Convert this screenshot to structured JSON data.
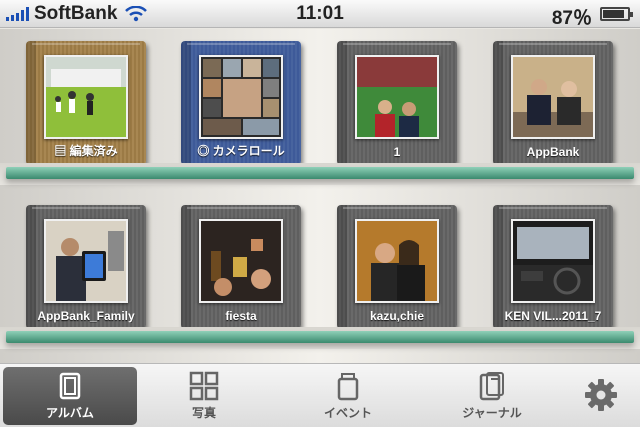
{
  "status_bar": {
    "carrier": "SoftBank",
    "time": "11:01",
    "battery_percent": "87％",
    "battery_level": 0.87
  },
  "shelves": [
    {
      "albums": [
        {
          "label": "編集済み",
          "icon": "edited-icon",
          "cover": "leather",
          "photo_scene": "soccer-field"
        },
        {
          "label": "カメラロール",
          "icon": "camera-roll-icon",
          "cover": "blue",
          "photo_scene": "collage"
        },
        {
          "label": "1",
          "icon": "",
          "cover": "gray",
          "photo_scene": "stadium"
        },
        {
          "label": "AppBank",
          "icon": "",
          "cover": "gray",
          "photo_scene": "group-at-table"
        }
      ]
    },
    {
      "albums": [
        {
          "label": "AppBank_Family",
          "icon": "",
          "cover": "gray",
          "photo_scene": "man-with-ipad"
        },
        {
          "label": "fiesta",
          "icon": "",
          "cover": "gray",
          "photo_scene": "party-toast"
        },
        {
          "label": "kazu,chie",
          "icon": "",
          "cover": "gray",
          "photo_scene": "couple"
        },
        {
          "label": "KEN VIL...2011_7",
          "icon": "",
          "cover": "gray",
          "photo_scene": "car-interior"
        }
      ]
    }
  ],
  "tab_bar": {
    "tabs": [
      {
        "label": "アルバム",
        "icon": "album-icon",
        "active": true
      },
      {
        "label": "写真",
        "icon": "grid-icon",
        "active": false
      },
      {
        "label": "イベント",
        "icon": "event-icon",
        "active": false
      },
      {
        "label": "ジャーナル",
        "icon": "journal-icon",
        "active": false
      }
    ],
    "settings_icon": "gear-icon"
  },
  "colors": {
    "shelf": "#3a8a6e",
    "active_tab": "#4a4a4a",
    "signal": "#1a4fb5"
  }
}
